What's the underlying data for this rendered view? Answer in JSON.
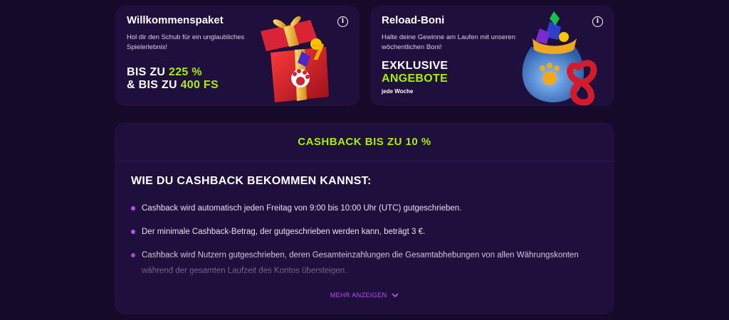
{
  "welcome": {
    "title": "Willkommenspaket",
    "desc": "Hol dir den Schub für ein unglaubliches Spielerlebnis!",
    "line1_prefix": "BIS ZU ",
    "line1_value": "225 %",
    "line2_prefix": "& BIS ZU ",
    "line2_value": "400 FS"
  },
  "reload": {
    "title": "Reload-Boni",
    "desc": "Halte deine Gewinne am Laufen mit unseren wöchentlichen Boni!",
    "line1": "EXKLUSIVE",
    "line2": "ANGEBOTE",
    "frequency": "jede Woche"
  },
  "info_icon_glyph": "i",
  "cashback": {
    "title": "CASHBACK BIS ZU 10 %",
    "how_title": "WIE DU CASHBACK BEKOMMEN KANNST:",
    "bullets": [
      "Cashback wird automatisch jeden Freitag von 9:00 bis 10:00 Uhr (UTC) gutgeschrieben.",
      "Der minimale Cashback-Betrag, der gutgeschrieben werden kann, beträgt 3 €.",
      "Cashback wird Nutzern gutgeschrieben, deren Gesamteinzahlungen die Gesamtabhebungen von allen Währungskonten während der gesamten Laufzeit des Kontos übersteigen."
    ],
    "show_more": "MEHR ANZEIGEN"
  },
  "colors": {
    "background": "#150a2a",
    "card": "#1f0f3d",
    "accent_green": "#a8f000",
    "accent_purple": "#c548ff"
  },
  "icons": {
    "info": "info-icon",
    "gift": "gift-box-icon",
    "bag": "treasure-bag-icon",
    "chevron": "chevron-down-icon"
  }
}
